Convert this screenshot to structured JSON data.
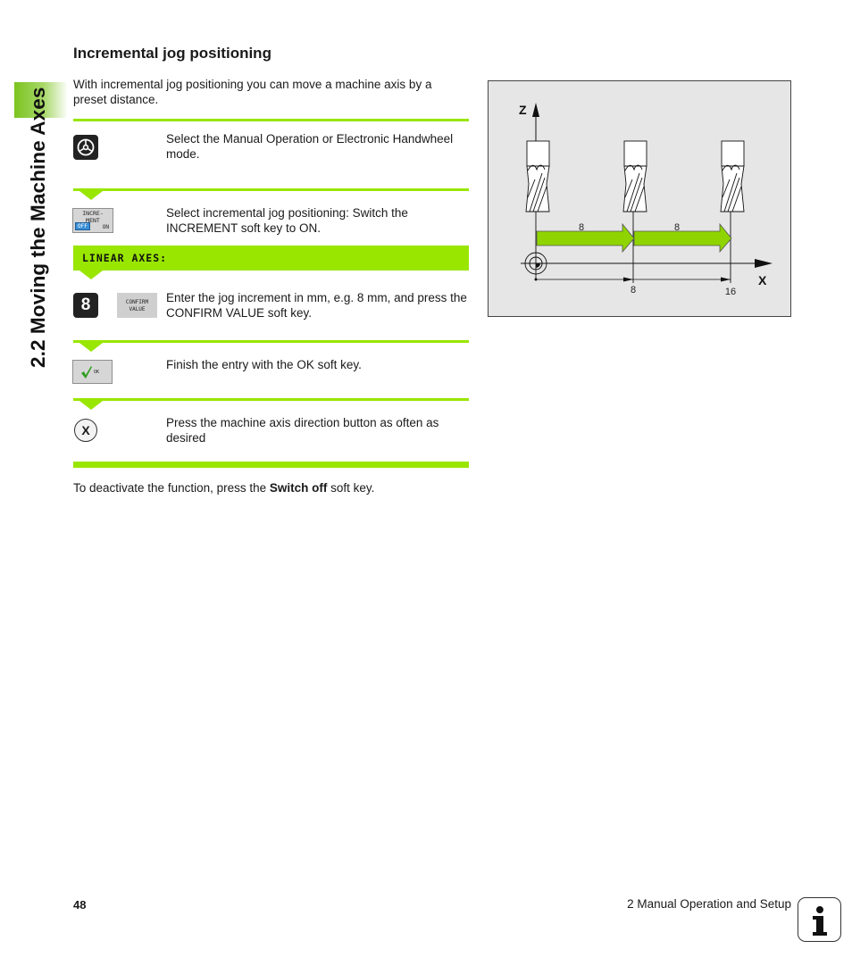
{
  "sidebar": {
    "chapter_title": "2.2 Moving the Machine Axes"
  },
  "section": {
    "title": "Incremental jog positioning",
    "intro": "With incremental jog positioning you can move a machine axis by a preset distance."
  },
  "steps": [
    {
      "icon": "handwheel-mode-key-icon",
      "text": "Select the Manual Operation or Electronic Handwheel mode."
    },
    {
      "icon": "increment-softkey-icon",
      "text": "Select incremental jog positioning: Switch the INCREMENT soft key to ON.",
      "softkey": {
        "line1": "INCRE-",
        "line2": "MENT",
        "off": "OFF",
        "on": "ON"
      }
    },
    {
      "icon": "digit-8-key-icon",
      "key_label": "8",
      "text": "Enter the jog increment in mm, e.g. 8 mm, and press the CONFIRM VALUE soft key.",
      "softkey": {
        "line1": "CONFIRM",
        "line2": "VALUE"
      }
    },
    {
      "icon": "ok-softkey-icon",
      "text": "Finish the entry with the OK soft key.",
      "softkey": {
        "label": "OK"
      }
    },
    {
      "icon": "x-axis-key-icon",
      "key_label": "X",
      "text": "Press the machine axis direction button as often as desired"
    }
  ],
  "dialog_prompt": "LINEAR AXES:",
  "deactivate": {
    "prefix": "To deactivate the function, press the ",
    "bold": "Switch off",
    "suffix": " soft key."
  },
  "figure": {
    "z_label": "Z",
    "x_label": "X",
    "increment_labels": [
      "8",
      "8"
    ],
    "position_labels": [
      "8",
      "16"
    ],
    "arrow_color": "#8fd400"
  },
  "footer": {
    "page_number": "48",
    "chapter": "2 Manual Operation and Setup",
    "info_icon": "i"
  },
  "colors": {
    "accent_green": "#99e600"
  }
}
